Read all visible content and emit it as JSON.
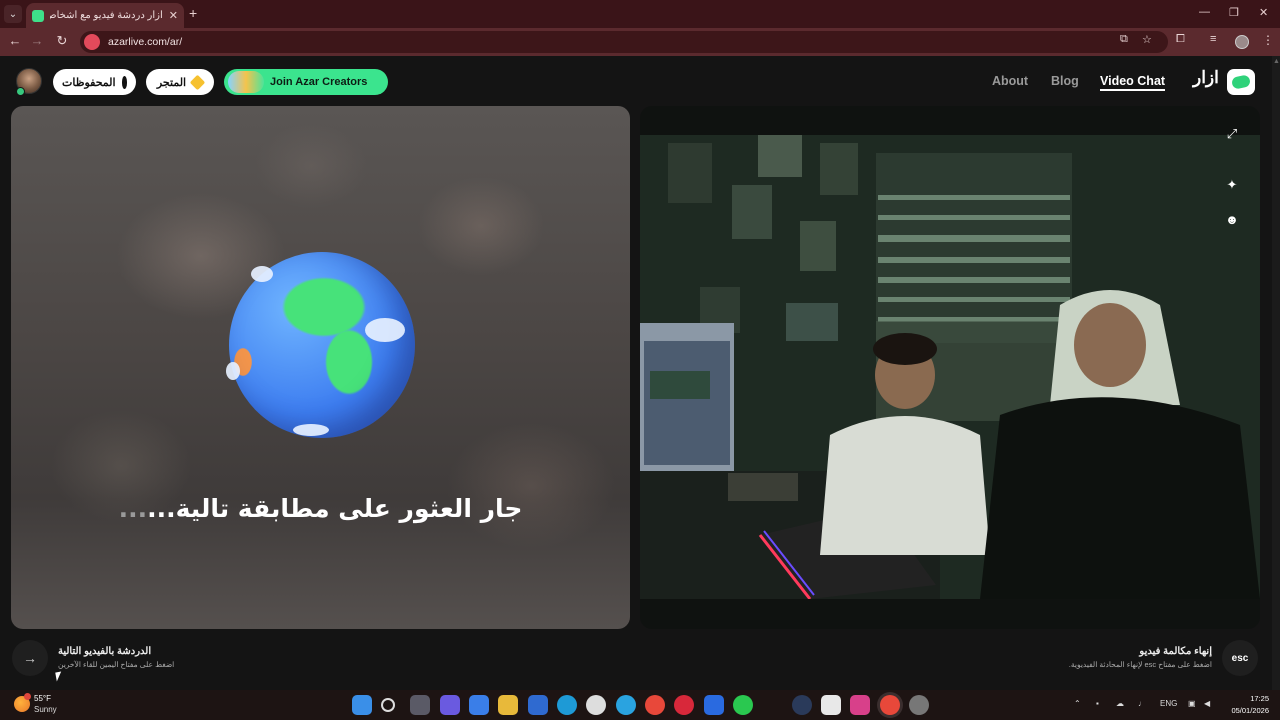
{
  "browser": {
    "tab_title": "أزار دردشة فيديو مع أشخاص",
    "url": "azarlive.com/ar/",
    "new_tab": "+",
    "close": "✕"
  },
  "header": {
    "saved_label": "المحفوظات",
    "store_label": "المتجر",
    "creators_label": "Join Azar Creators",
    "nav": {
      "about": "About",
      "blog": "Blog",
      "video_chat": "Video Chat"
    },
    "logo_text": "ازار"
  },
  "match": {
    "status_text": "جار العثور على مطابقة تالية",
    "dots_white": "...",
    "dots_grey": "..."
  },
  "controls": {
    "next_title": "الدردشة بالفيديو التالية",
    "next_hint": "اضغط على مفتاح اليمين للقاء الآخرين",
    "end_title": "إنهاء مكالمة فيديو",
    "end_hint": "اضغط على مفتاح esc لإنهاء المحادثة الفيديوية.",
    "esc_label": "esc"
  },
  "taskbar": {
    "temperature": "55°F",
    "condition": "Sunny",
    "language": "ENG",
    "time": "17:25",
    "date": "05/01/2026"
  },
  "colors": {
    "accent": "#3be48e",
    "tab_bar": "#3a1418",
    "toolbar": "#5b2a2e"
  }
}
